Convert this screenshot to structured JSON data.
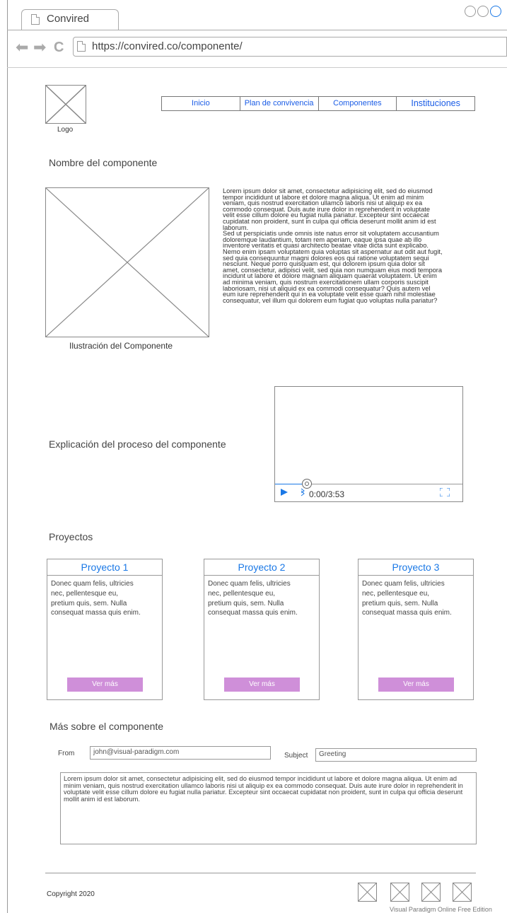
{
  "browser": {
    "tab_title": "Convired",
    "url": "https://convired.co/componente/"
  },
  "header": {
    "logo_label": "Logo",
    "nav": [
      "Inicio",
      "Plan de convivencia",
      "Componentes",
      "Instituciones"
    ]
  },
  "component": {
    "title": "Nombre del componente",
    "illustration_label": "Ilustración del Componente",
    "description": "Lorem ipsum dolor sit amet, consectetur adipisicing elit, sed do eiusmod\ntempor incididunt ut labore et dolore magna aliqua. Ut enim ad minim\nveniam, quis nostrud exercitation ullamco laboris nisi ut aliquip ex ea\ncommodo consequat. Duis aute irure dolor in reprehenderit in voluptate\nvelit esse cillum dolore eu fugiat nulla pariatur. Excepteur sint occaecat\ncupidatat non proident, sunt in culpa qui officia deserunt mollit anim id est\nlaborum.\nSed ut perspiciatis unde omnis iste natus error sit voluptatem accusantium\ndoloremque laudantium, totam rem aperiam, eaque ipsa quae ab illo\ninventore veritatis et quasi architecto beatae vitae dicta sunt explicabo.\nNemo enim ipsam voluptatem quia voluptas sit aspernatur aut odit aut fugit,\nsed quia consequuntur magni dolores eos qui ratione voluptatem sequi\nnesciunt. Neque porro quisquam est, qui dolorem ipsum quia dolor sit\namet, consectetur, adipisci velit, sed quia non numquam eius modi tempora\nincidunt ut labore et dolore magnam aliquam quaerat voluptatem. Ut enim\nad minima veniam, quis nostrum exercitationem ullam corporis suscipit\nlaboriosam, nisi ut aliquid ex ea commodi consequatur? Quis autem vel\neum iure reprehenderit qui in ea voluptate velit esse quam nihil molestiae\nconsequatur, vel illum qui dolorem eum fugiat quo voluptas nulla pariatur?"
  },
  "process": {
    "title": "Explicación del proceso del componente",
    "video_time": "0:00/3:53",
    "progress": 0.17
  },
  "projects": {
    "title": "Proyectos",
    "items": [
      {
        "title": "Proyecto 1",
        "text": "Donec quam felis, ultricies nec, pellentesque eu, pretium quis, sem. Nulla consequat massa quis enim.",
        "button": "Ver más"
      },
      {
        "title": "Proyecto 2",
        "text": "Donec quam felis, ultricies nec, pellentesque eu, pretium quis, sem. Nulla consequat massa quis enim.",
        "button": "Ver más"
      },
      {
        "title": "Proyecto 3",
        "text": "Donec quam felis, ultricies nec, pellentesque eu, pretium quis, sem. Nulla consequat massa quis enim.",
        "button": "Ver más"
      }
    ]
  },
  "contact": {
    "title": "Más sobre el componente",
    "from_label": "From",
    "from_value": "john@visual-paradigm.com",
    "subject_label": "Subject",
    "subject_value": "Greeting",
    "message": "Lorem ipsum dolor sit amet, consectetur adipisicing elit, sed do eiusmod tempor incididunt ut labore et dolore magna aliqua. Ut enim ad minim veniam, quis nostrud exercitation ullamco laboris nisi ut aliquip ex ea commodo consequat. Duis aute irure dolor in reprehenderit in voluptate velit esse cillum dolore eu fugiat nulla pariatur. Excepteur sint occaecat cupidatat non proident, sunt in culpa qui officia deserunt mollit anim id est laborum."
  },
  "footer": {
    "copyright": "Copyright 2020",
    "watermark": "Visual Paradigm Online Free Edition"
  },
  "colors": {
    "link": "#1a5ce6",
    "project_title": "#1a78e6",
    "button": "#cf8fd9",
    "video_accent": "#1a78e6"
  }
}
